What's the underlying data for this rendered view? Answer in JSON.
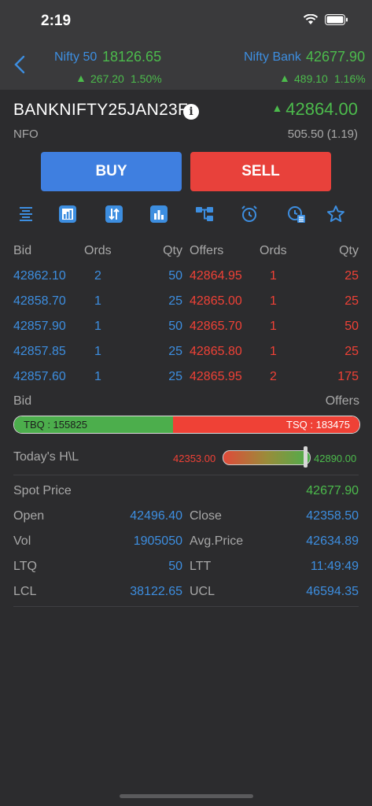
{
  "status_bar": {
    "time": "2:19"
  },
  "header": {
    "index1": {
      "name": "Nifty 50",
      "value": "18126.65",
      "change": "267.20",
      "pct": "1.50%"
    },
    "index2": {
      "name": "Nifty Bank",
      "value": "42677.90",
      "change": "489.10",
      "pct": "1.16%"
    }
  },
  "instrument": {
    "symbol": "BANKNIFTY25JAN23F",
    "info_glyph": "i",
    "ltp": "42864.00",
    "exchange": "NFO",
    "change": "505.50 (1.19)"
  },
  "actions": {
    "buy_label": "BUY",
    "sell_label": "SELL"
  },
  "toolbar": {
    "icons": [
      "list-icon",
      "chart-bar-icon",
      "arrows-icon",
      "bar-chart-icon",
      "tree-icon",
      "alarm-icon",
      "clock-doc-icon",
      "star-icon"
    ]
  },
  "depth": {
    "headers": {
      "bid": "Bid",
      "ords": "Ords",
      "qty": "Qty",
      "offers": "Offers",
      "ords2": "Ords",
      "qty2": "Qty"
    },
    "rows": [
      {
        "bid": "42862.10",
        "bid_ords": "2",
        "bid_qty": "50",
        "offer": "42864.95",
        "offer_ords": "1",
        "offer_qty": "25"
      },
      {
        "bid": "42858.70",
        "bid_ords": "1",
        "bid_qty": "25",
        "offer": "42865.00",
        "offer_ords": "1",
        "offer_qty": "25"
      },
      {
        "bid": "42857.90",
        "bid_ords": "1",
        "bid_qty": "50",
        "offer": "42865.70",
        "offer_ords": "1",
        "offer_qty": "50"
      },
      {
        "bid": "42857.85",
        "bid_ords": "1",
        "bid_qty": "25",
        "offer": "42865.80",
        "offer_ords": "1",
        "offer_qty": "25"
      },
      {
        "bid": "42857.60",
        "bid_ords": "1",
        "bid_qty": "25",
        "offer": "42865.95",
        "offer_ords": "2",
        "offer_qty": "175"
      }
    ]
  },
  "pressure": {
    "bid_label": "Bid",
    "offers_label": "Offers",
    "tbq": "TBQ : 155825",
    "tsq": "TSQ : 183475",
    "bid_fraction": 0.459
  },
  "todays_range": {
    "label": "Today's H\\L",
    "low": "42353.00",
    "high": "42890.00",
    "position": 0.958
  },
  "stats": {
    "spot_label": "Spot Price",
    "spot": "42677.90",
    "open_label": "Open",
    "open": "42496.40",
    "close_label": "Close",
    "close": "42358.50",
    "vol_label": "Vol",
    "vol": "1905050",
    "avg_label": "Avg.Price",
    "avg": "42634.89",
    "ltq_label": "LTQ",
    "ltq": "50",
    "ltt_label": "LTT",
    "ltt": "11:49:49",
    "lcl_label": "LCL",
    "lcl": "38122.65",
    "ucl_label": "UCL",
    "ucl": "46594.35"
  },
  "colors": {
    "accent_blue": "#3d8ee0",
    "up_green": "#4cbb4c",
    "down_red": "#ef4136",
    "buy": "#3f7fe0",
    "sell": "#e8413b"
  }
}
